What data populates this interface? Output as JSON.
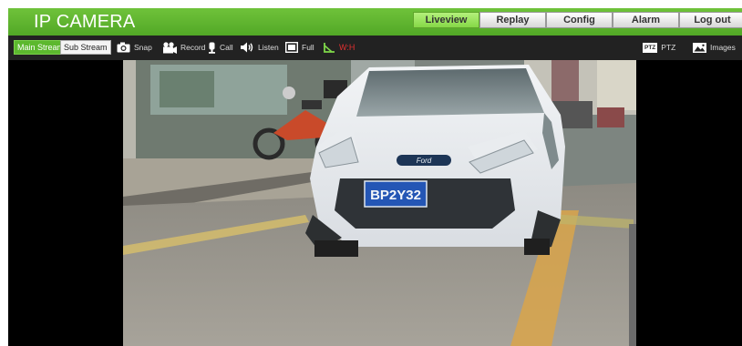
{
  "app": {
    "title": "IP CAMERA"
  },
  "nav": [
    {
      "label": "Liveview",
      "active": true
    },
    {
      "label": "Replay",
      "active": false
    },
    {
      "label": "Config",
      "active": false
    },
    {
      "label": "Alarm",
      "active": false
    },
    {
      "label": "Log out",
      "active": false
    }
  ],
  "streams": {
    "main": "Main Stream",
    "sub": "Sub Stream",
    "active": "Main Stream"
  },
  "tools": {
    "snap": "Snap",
    "record": "Record",
    "call": "Call",
    "listen": "Listen",
    "full": "Full",
    "wh": "W:H",
    "ptz_badge": "PTZ",
    "ptz": "PTZ",
    "images": "Images"
  },
  "video": {
    "plate": "BP2Y32",
    "badge": "Ford"
  },
  "colors": {
    "header": "#5ab52c",
    "active_button": "#9be561",
    "toolbar": "#222222",
    "wh": "#e23030"
  }
}
